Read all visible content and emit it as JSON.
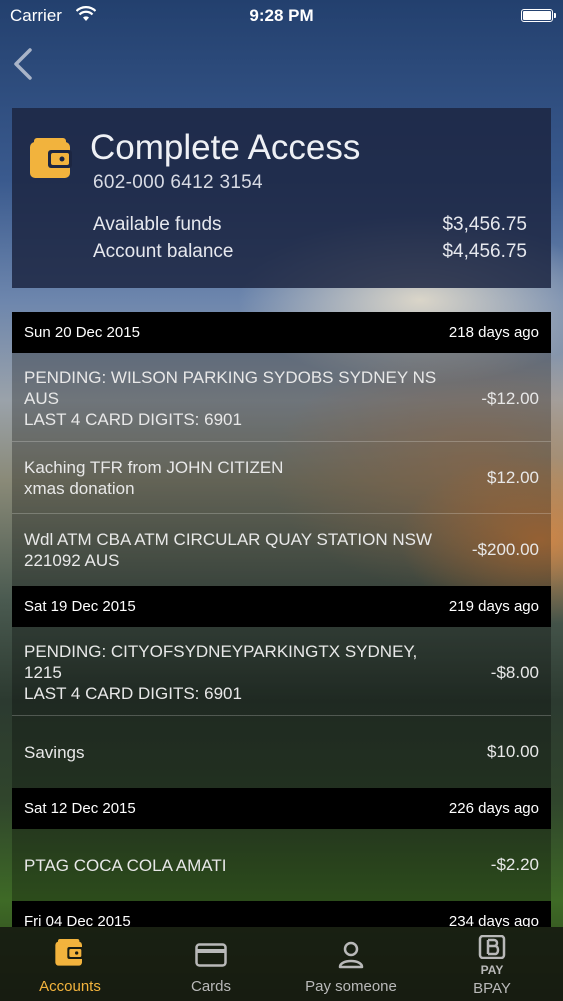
{
  "status_bar": {
    "carrier": "Carrier",
    "time": "9:28 PM"
  },
  "account": {
    "name": "Complete Access",
    "number": "602-000 6412 3154",
    "available_label": "Available funds",
    "available_value": "$3,456.75",
    "balance_label": "Account balance",
    "balance_value": "$4,456.75"
  },
  "groups": [
    {
      "date": "Sun 20 Dec 2015",
      "ago": "218 days ago",
      "items": [
        {
          "desc": "PENDING: WILSON PARKING SYDOBS SYDNEY NS AUS\nLAST 4 CARD DIGITS: 6901",
          "amount": "-$12.00"
        },
        {
          "desc": "Kaching TFR from JOHN CITIZEN\nxmas donation",
          "amount": "$12.00"
        },
        {
          "desc": "Wdl ATM CBA ATM CIRCULAR QUAY STATION NSW 221092 AUS",
          "amount": "-$200.00"
        }
      ]
    },
    {
      "date": "Sat 19 Dec 2015",
      "ago": "219 days ago",
      "items": [
        {
          "desc": "PENDING: CITYOFSYDNEYPARKINGTX SYDNEY, 1215\nLAST 4 CARD DIGITS: 6901",
          "amount": "-$8.00"
        },
        {
          "desc": "Savings",
          "amount": "$10.00"
        }
      ]
    },
    {
      "date": "Sat 12 Dec 2015",
      "ago": "226 days ago",
      "items": [
        {
          "desc": "PTAG COCA COLA AMATI",
          "amount": "-$2.20"
        }
      ]
    },
    {
      "date": "Fri 04 Dec 2015",
      "ago": "234 days ago",
      "items": []
    }
  ],
  "tabs": {
    "accounts": "Accounts",
    "cards": "Cards",
    "pay_someone": "Pay someone",
    "bpay": "BPAY",
    "bpay_pay": "PAY",
    "active_color": "#f2b33d",
    "inactive_color": "#b9b9b9"
  }
}
